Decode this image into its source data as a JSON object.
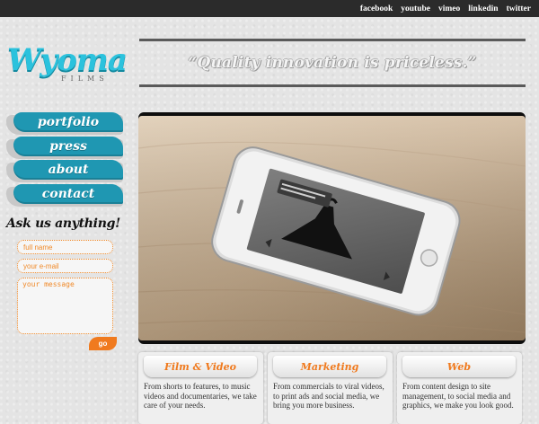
{
  "topbar": {
    "links": [
      "facebook",
      "youtube",
      "vimeo",
      "linkedin",
      "twitter"
    ]
  },
  "logo": {
    "name": "Wyoma",
    "sub": "FILMS"
  },
  "slogan": "“Quality innovation is priceless.”",
  "nav": {
    "items": [
      "portfolio",
      "press",
      "about",
      "contact"
    ]
  },
  "contact_form": {
    "heading": "Ask us anything!",
    "name_placeholder": "full name",
    "email_placeholder": "your e-mail",
    "message_placeholder": "your message",
    "submit_label": "go"
  },
  "hero": {
    "phone_screen_text": "A personal Dunce coat with Lunaria designers, your designer giving.",
    "icon": "phone-photo"
  },
  "services": [
    {
      "title": "Film & Video",
      "desc": "From shorts to features, to music videos and documentaries, we take care of your needs."
    },
    {
      "title": "Marketing",
      "desc": "From commercials to viral videos, to print ads and social media, we bring you more business."
    },
    {
      "title": "Web",
      "desc": "From content design to site management, to social media and graphics, we make you look good."
    }
  ],
  "colors": {
    "brand": "#2bc2dd",
    "nav": "#1f97b2",
    "accent": "#f07a1e",
    "topbar": "#2b2b2b"
  }
}
